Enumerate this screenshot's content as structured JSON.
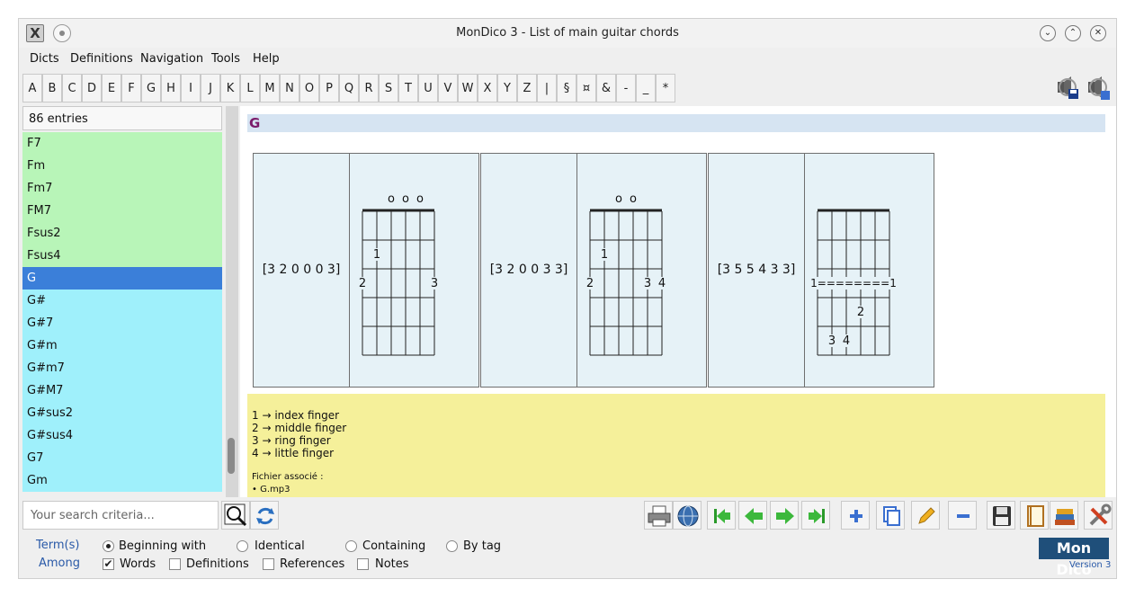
{
  "window": {
    "title": "MonDico 3 - List of main guitar chords"
  },
  "menubar": [
    "Dicts",
    "Definitions",
    "Navigation",
    "Tools",
    "Help"
  ],
  "letters": [
    "A",
    "B",
    "C",
    "D",
    "E",
    "F",
    "G",
    "H",
    "I",
    "J",
    "K",
    "L",
    "M",
    "N",
    "O",
    "P",
    "Q",
    "R",
    "S",
    "T",
    "U",
    "V",
    "W",
    "X",
    "Y",
    "Z",
    "|",
    "§",
    "¤",
    "&",
    "-",
    "_",
    "*"
  ],
  "wordlist": {
    "count_label": "86 entries",
    "items": [
      {
        "label": "F7",
        "group": "green"
      },
      {
        "label": "Fm",
        "group": "green"
      },
      {
        "label": "Fm7",
        "group": "green"
      },
      {
        "label": "FM7",
        "group": "green"
      },
      {
        "label": "Fsus2",
        "group": "green"
      },
      {
        "label": "Fsus4",
        "group": "green"
      },
      {
        "label": "G",
        "group": "selected"
      },
      {
        "label": "G#",
        "group": "cyan"
      },
      {
        "label": "G#7",
        "group": "cyan"
      },
      {
        "label": "G#m",
        "group": "cyan"
      },
      {
        "label": "G#m7",
        "group": "cyan"
      },
      {
        "label": "G#M7",
        "group": "cyan"
      },
      {
        "label": "G#sus2",
        "group": "cyan"
      },
      {
        "label": "G#sus4",
        "group": "cyan"
      },
      {
        "label": "G7",
        "group": "cyan"
      },
      {
        "label": "Gm",
        "group": "cyan"
      }
    ],
    "colors": {
      "green": "#b8f5b8",
      "cyan": "#9ff0fb",
      "selected": "#3b7fd9"
    }
  },
  "entry": {
    "headword": "G",
    "chords": [
      {
        "fingering": "[3 2 0 0 0 3]",
        "top_marks": [
          {
            "string": 3,
            "text": "o"
          },
          {
            "string": 4,
            "text": "o"
          },
          {
            "string": 5,
            "text": "o"
          }
        ],
        "fingers": [
          {
            "string": 2,
            "fret": 2,
            "text": "1"
          },
          {
            "string": 1,
            "fret": 3,
            "text": "2"
          },
          {
            "string": 6,
            "fret": 3,
            "text": "3"
          }
        ],
        "barre": null
      },
      {
        "fingering": "[3 2 0 0 3 3]",
        "top_marks": [
          {
            "string": 3,
            "text": "o"
          },
          {
            "string": 4,
            "text": "o"
          }
        ],
        "fingers": [
          {
            "string": 2,
            "fret": 2,
            "text": "1"
          },
          {
            "string": 1,
            "fret": 3,
            "text": "2"
          },
          {
            "string": 5,
            "fret": 3,
            "text": "3"
          },
          {
            "string": 6,
            "fret": 3,
            "text": "4"
          }
        ],
        "barre": null
      },
      {
        "fingering": "[3 5 5 4 3 3]",
        "top_marks": [],
        "fingers": [
          {
            "string": 4,
            "fret": 4,
            "text": "2"
          },
          {
            "string": 2,
            "fret": 5,
            "text": "3"
          },
          {
            "string": 3,
            "fret": 5,
            "text": "4"
          }
        ],
        "barre": {
          "fret": 3,
          "text": "1========1"
        }
      }
    ],
    "notes": [
      "1 → index finger",
      "2 → middle finger",
      "3 → ring finger",
      "4 → little finger"
    ],
    "file_label": "Fichier associé :",
    "file_name": "• G.mp3"
  },
  "search": {
    "placeholder": "Your search criteria..."
  },
  "options": {
    "term_label": "Term(s)",
    "among_label": "Among",
    "radios": [
      {
        "label": "Beginning with",
        "checked": true
      },
      {
        "label": "Identical",
        "checked": false
      },
      {
        "label": "Containing",
        "checked": false
      },
      {
        "label": "By tag",
        "checked": false
      }
    ],
    "checks": [
      {
        "label": "Words",
        "checked": true
      },
      {
        "label": "Definitions",
        "checked": false
      },
      {
        "label": "References",
        "checked": false
      },
      {
        "label": "Notes",
        "checked": false
      }
    ]
  },
  "logo": {
    "text": "Mon Dico",
    "version": "Version 3"
  }
}
